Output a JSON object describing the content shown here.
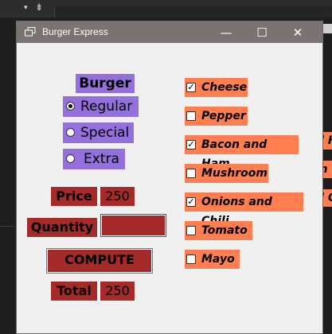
{
  "window": {
    "title": "Burger Express",
    "controls": {
      "minimize": "—",
      "maximize": "☐",
      "close": "✕"
    }
  },
  "burger": {
    "heading": "Burger",
    "options": [
      {
        "label": "Regular",
        "selected": true
      },
      {
        "label": "Special",
        "selected": false
      },
      {
        "label": "Extra",
        "selected": false
      }
    ]
  },
  "toppings": [
    {
      "label": "Cheese",
      "checked": true
    },
    {
      "label": "Pepper",
      "checked": false
    },
    {
      "label": "Bacon and Ham",
      "checked": true
    },
    {
      "label": "Mushroom",
      "checked": false
    },
    {
      "label": "Onions and Chili",
      "checked": true
    },
    {
      "label": "Tomato",
      "checked": false
    },
    {
      "label": "Mayo",
      "checked": false
    }
  ],
  "price": {
    "label": "Price",
    "value": "250"
  },
  "quantity": {
    "label": "Quantity",
    "value": ""
  },
  "compute": {
    "label": "COMPUTE"
  },
  "total": {
    "label": "Total",
    "value": "250"
  },
  "background_peek": [
    "d H",
    "m",
    "d Ch"
  ],
  "colors": {
    "label_bg": "#a52a2a",
    "radio_bg": "#9370db",
    "check_bg": "#ff7f50",
    "titlebar": "#7a7371"
  }
}
